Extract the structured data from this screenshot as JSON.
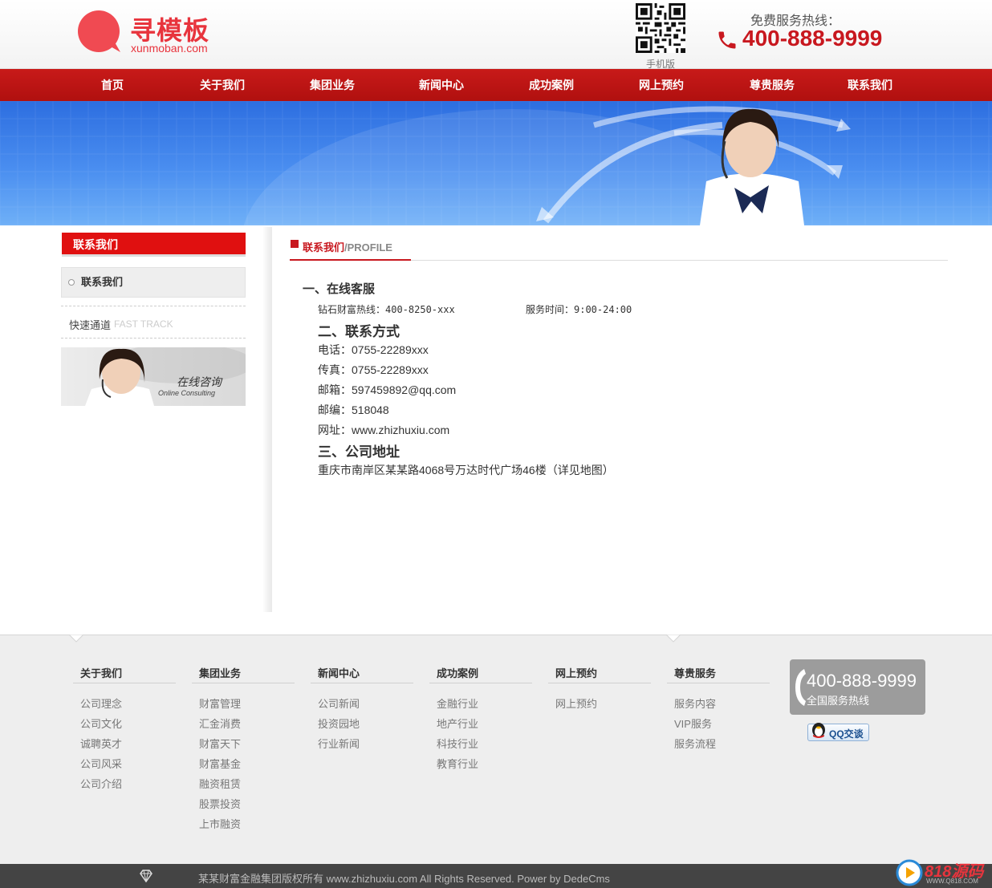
{
  "header": {
    "logo_cn": "寻模板",
    "logo_en": "xunmoban.com",
    "qr_label": "手机版",
    "hotline_title": "免费服务热线：",
    "hotline_number": "400-888-9999"
  },
  "nav": {
    "items": [
      "首页",
      "关于我们",
      "集团业务",
      "新闻中心",
      "成功案例",
      "网上预约",
      "尊贵服务",
      "联系我们"
    ]
  },
  "sidebar": {
    "title": "联系我们",
    "item": "联系我们",
    "fast_cn": "快速通道",
    "fast_en": "FAST TRACK",
    "consult_cn": "在线咨询",
    "consult_en": "Online Consulting"
  },
  "content": {
    "crumb_title": "联系我们",
    "crumb_en": "/PROFILE",
    "section1": "一、在线客服",
    "hotline": "钻石财富热线：400-8250-xxx",
    "service_time": "服务时间：9:00-24:00",
    "section2": "二、联系方式",
    "phone": "电话：0755-22289xxx",
    "fax": "传真：0755-22289xxx",
    "email": "邮箱：597459892@qq.com",
    "postcode": "邮编：518048",
    "website": "网址：www.zhizhuxiu.com",
    "section3": "三、公司地址",
    "address": "重庆市南岸区某某路4068号万达时代广场46楼（详见地图）"
  },
  "footer": {
    "columns": [
      {
        "title": "关于我们",
        "links": [
          "公司理念",
          "公司文化",
          "诚聘英才",
          "公司风采",
          "公司介绍"
        ]
      },
      {
        "title": "集团业务",
        "links": [
          "财富管理",
          "汇金消费",
          "财富天下",
          "财富基金",
          "融资租赁",
          "股票投资",
          "上市融资"
        ]
      },
      {
        "title": "新闻中心",
        "links": [
          "公司新闻",
          "投资园地",
          "行业新闻"
        ]
      },
      {
        "title": "成功案例",
        "links": [
          "金融行业",
          "地产行业",
          "科技行业",
          "教育行业"
        ]
      },
      {
        "title": "网上预约",
        "links": [
          "网上预约"
        ]
      },
      {
        "title": "尊贵服务",
        "links": [
          "服务内容",
          "VIP服务",
          "服务流程"
        ]
      }
    ],
    "hotline_number": "400-888-9999",
    "hotline_label": "全国服务热线",
    "qq_label": "QQ交谈",
    "copyright": "某某财富金融集团版权所有 www.zhizhuxiu.com All Rights Reserved. Power by DedeCms"
  },
  "watermark": {
    "text": "818源码",
    "sub": "WWW.Q818.COM"
  },
  "colors": {
    "brand_red": "#c8181f",
    "logo_red": "#e8343d",
    "banner_blue": "#2d6ee0"
  }
}
